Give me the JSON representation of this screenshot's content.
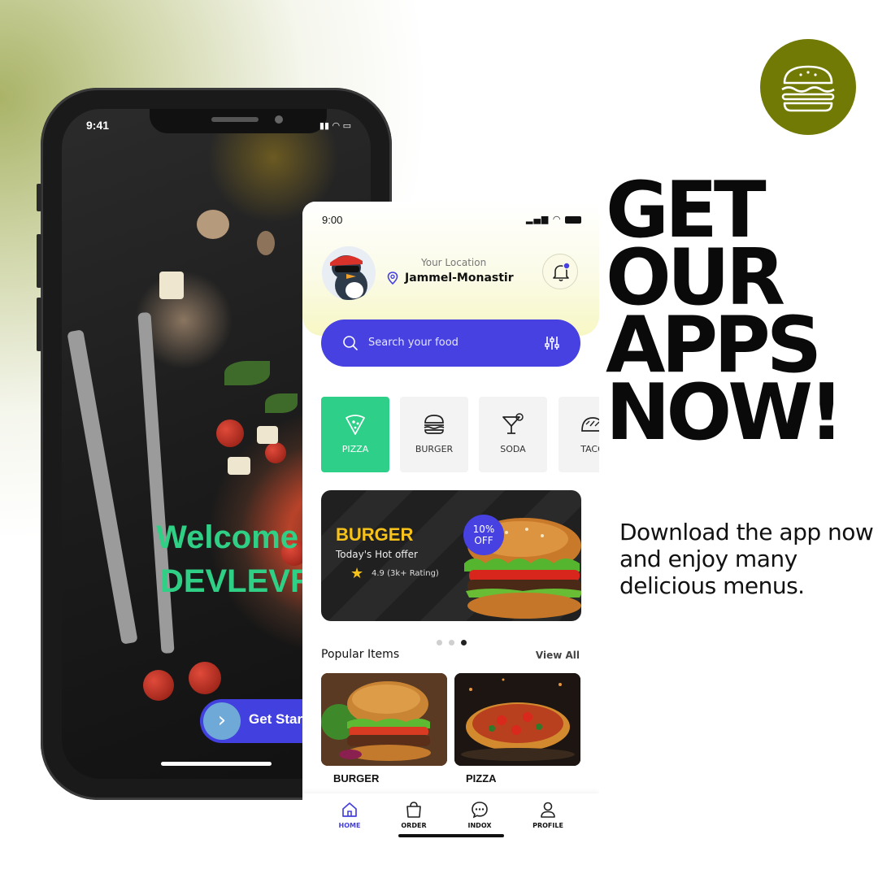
{
  "colors": {
    "accent_purple": "#4641e0",
    "accent_green": "#2ed089",
    "badge_olive": "#727a06",
    "offer_yellow": "#f7c21a"
  },
  "promo": {
    "headline_lines": [
      "GET",
      "OUR",
      "APPS",
      "NOW!"
    ],
    "subtext": "Download the app now and enjoy many delicious  menus.",
    "badge_icon": "burger-icon"
  },
  "back_phone": {
    "time": "9:41",
    "welcome_line1": "Welcome to",
    "welcome_line2": "DEVLEVRY",
    "cta_label": "Get Started"
  },
  "app": {
    "status_time": "9:00",
    "location_label": "Your Location",
    "location_value": "Jammel-Monastir",
    "search_placeholder": "Search your food",
    "categories": [
      {
        "label": "PIZZA",
        "icon": "pizza-icon",
        "active": true
      },
      {
        "label": "BURGER",
        "icon": "burger-icon",
        "active": false
      },
      {
        "label": "SODA",
        "icon": "cocktail-icon",
        "active": false
      },
      {
        "label": "TACO",
        "icon": "taco-icon",
        "active": false
      }
    ],
    "offer": {
      "title": "BURGER",
      "subtitle": "Today's Hot offer",
      "rating": "4.9 (3k+ Rating)",
      "badge_line1": "10%",
      "badge_line2": "OFF"
    },
    "carousel_active_index": 2,
    "popular_title": "Popular Items",
    "view_all": "View All",
    "popular_items": [
      {
        "name": "BURGER"
      },
      {
        "name": "PIZZA"
      }
    ],
    "tabs": [
      {
        "label": "HOME",
        "icon": "home-icon",
        "active": true
      },
      {
        "label": "ORDER",
        "icon": "bag-icon",
        "active": false
      },
      {
        "label": "INDOX",
        "icon": "chat-icon",
        "active": false
      },
      {
        "label": "PROFILE",
        "icon": "user-icon",
        "active": false
      }
    ]
  }
}
